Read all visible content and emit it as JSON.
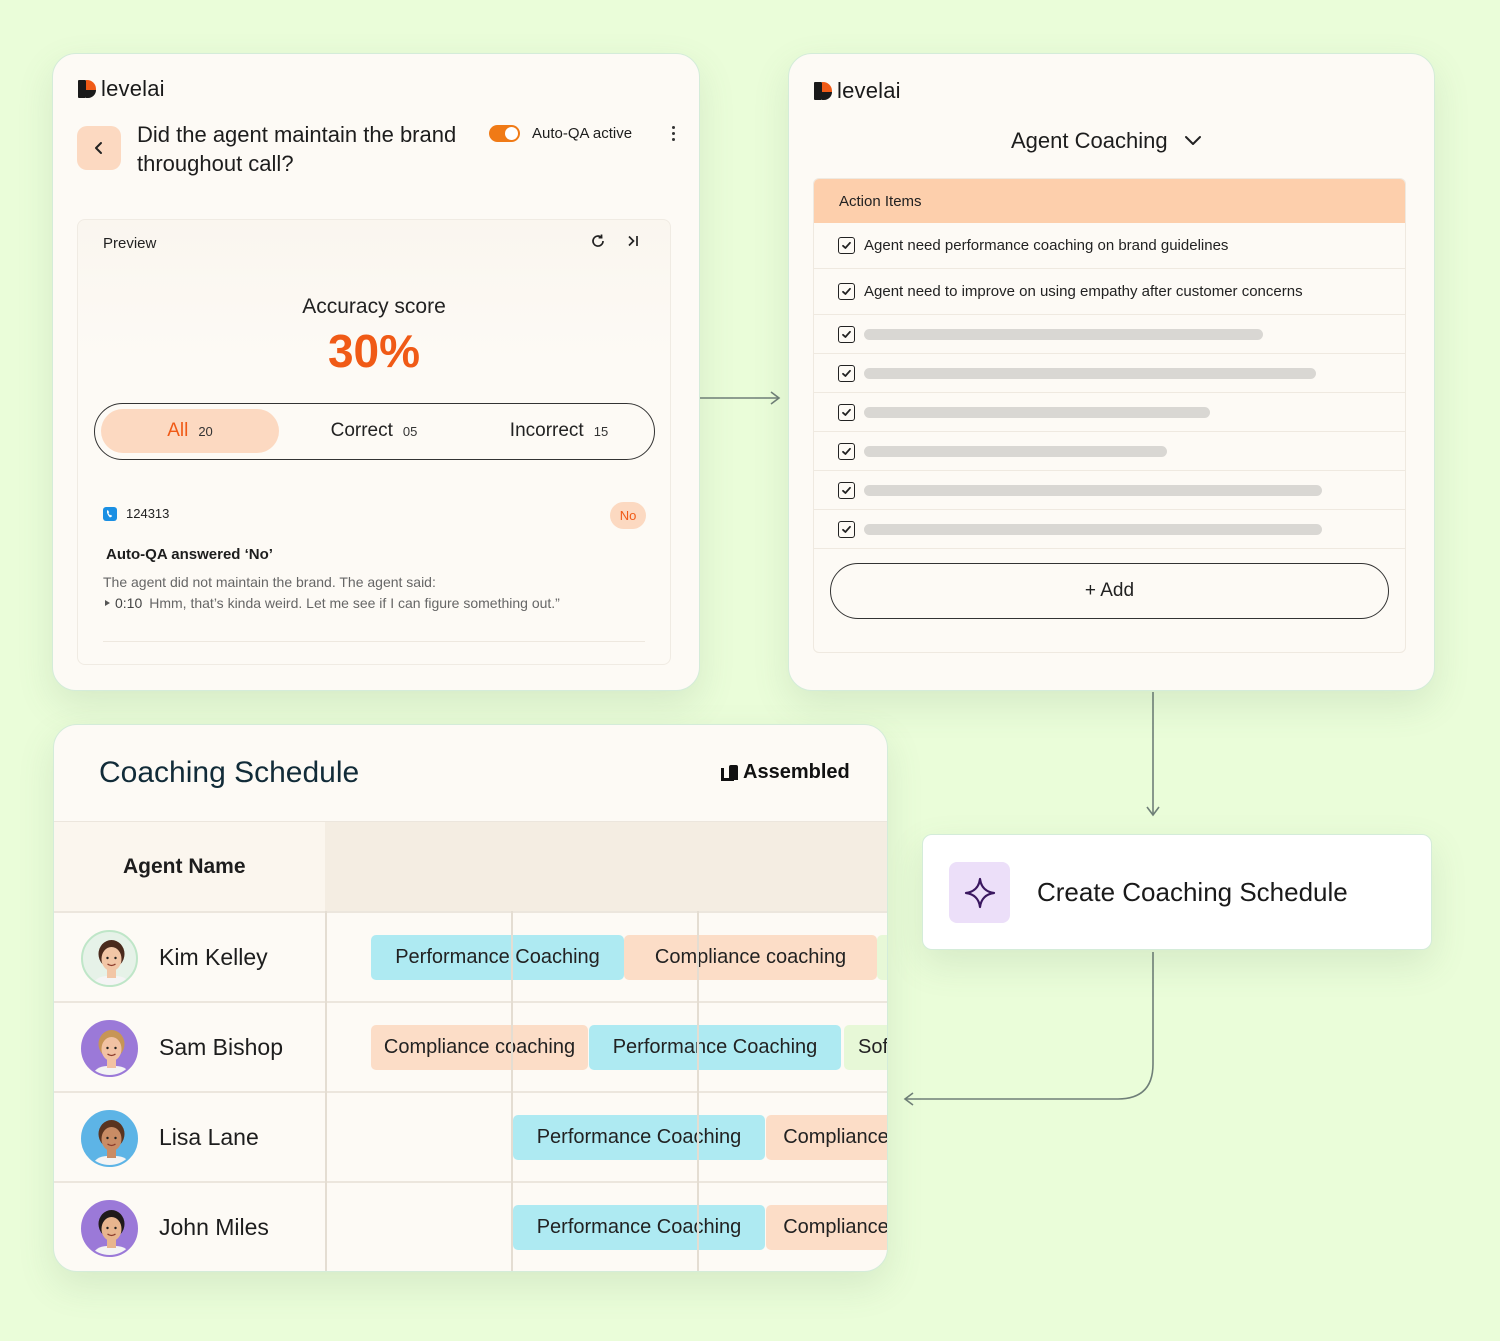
{
  "colors": {
    "background": "#eafdd9",
    "accent": "#f05a16",
    "peach": "#fcd9c1",
    "cyan": "#aeeaf2",
    "lavender": "#ecdff9"
  },
  "brand": {
    "name": "levelai"
  },
  "qa_card": {
    "question": "Did the agent maintain the brand throughout call?",
    "toggle_label": "Auto-QA active",
    "toggle_on": true,
    "preview_label": "Preview",
    "accuracy_label": "Accuracy score",
    "accuracy_value": "30%",
    "filters": [
      {
        "label": "All",
        "count": "20",
        "active": true
      },
      {
        "label": "Correct",
        "count": "05",
        "active": false
      },
      {
        "label": "Incorrect",
        "count": "15",
        "active": false
      }
    ],
    "call": {
      "id": "124313",
      "badge": "No",
      "answered": "Auto-QA answered ‘No’",
      "said": "The agent did not maintain the brand. The agent said:",
      "timestamp": "0:10",
      "quote": "Hmm, that’s kinda weird. Let me see if I can figure something out.”"
    },
    "icons": [
      "chevron-left-icon",
      "kebab-menu-icon",
      "refresh-icon",
      "skip-forward-icon",
      "phone-icon",
      "play-icon"
    ]
  },
  "coaching_card": {
    "title": "Agent Coaching",
    "action_items_header": "Action Items",
    "items": [
      "Agent need performance coaching on brand guidelines",
      "Agent need to improve on using empathy after customer concerns"
    ],
    "placeholder_fill": [
      0.75,
      0.85,
      0.65,
      0.57,
      0.86,
      0.86
    ],
    "add_label": "+ Add"
  },
  "schedule_card": {
    "title": "Coaching Schedule",
    "partner": "Assembled",
    "agent_header": "Agent Name",
    "rows": [
      {
        "name": "Kim Kelley",
        "pills": [
          {
            "label": "Performance Coaching",
            "kind": "perf"
          },
          {
            "label": "Compliance coaching",
            "kind": "comp"
          },
          {
            "label": "",
            "kind": "soft"
          }
        ]
      },
      {
        "name": "Sam Bishop",
        "pills": [
          {
            "label": "Compliance coaching",
            "kind": "comp"
          },
          {
            "label": "Performance Coaching",
            "kind": "perf"
          },
          {
            "label": "Soft",
            "kind": "soft"
          }
        ]
      },
      {
        "name": "Lisa Lane",
        "pills": [
          {
            "label": "Performance Coaching",
            "kind": "perf"
          },
          {
            "label": "Compliance",
            "kind": "comp"
          }
        ]
      },
      {
        "name": "John Miles",
        "pills": [
          {
            "label": "Performance Coaching",
            "kind": "perf"
          },
          {
            "label": "Compliance",
            "kind": "comp"
          }
        ]
      }
    ]
  },
  "cta": {
    "label": "Create Coaching Schedule",
    "icon": "sparkle-icon"
  }
}
